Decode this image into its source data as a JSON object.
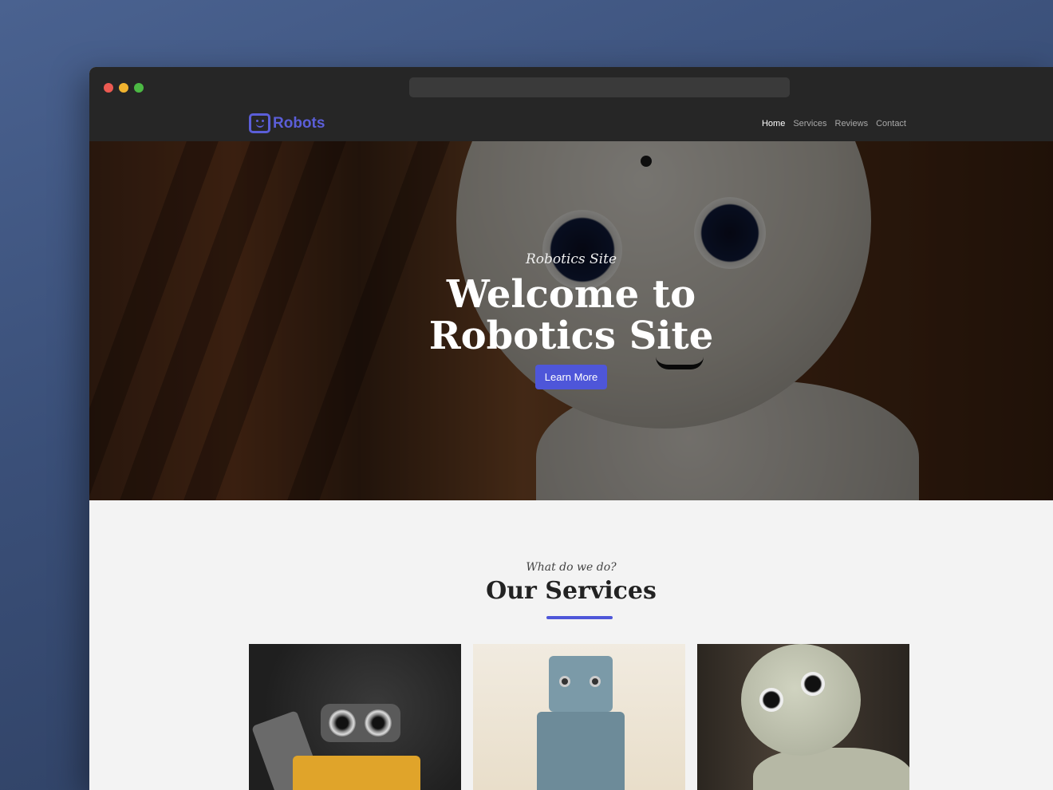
{
  "brand": {
    "name": "Robots",
    "accent_color": "#4e56d9",
    "logo_icon": "robot-face-icon"
  },
  "window": {
    "controls": [
      "close",
      "minimize",
      "maximize"
    ]
  },
  "nav": {
    "items": [
      {
        "label": "Home",
        "active": true
      },
      {
        "label": "Services",
        "active": false
      },
      {
        "label": "Reviews",
        "active": false
      },
      {
        "label": "Contact",
        "active": false
      }
    ]
  },
  "hero": {
    "script_text": "Robotics Site",
    "title_line1": "Welcome to",
    "title_line2": "Robotics Site",
    "button_label": "Learn More"
  },
  "services": {
    "script_text": "What do we do?",
    "title": "Our Services",
    "cards": [
      {
        "image": "yellow-robot-photo"
      },
      {
        "image": "tin-toy-robot-photo"
      },
      {
        "image": "white-humanoid-robot-photo"
      }
    ]
  }
}
